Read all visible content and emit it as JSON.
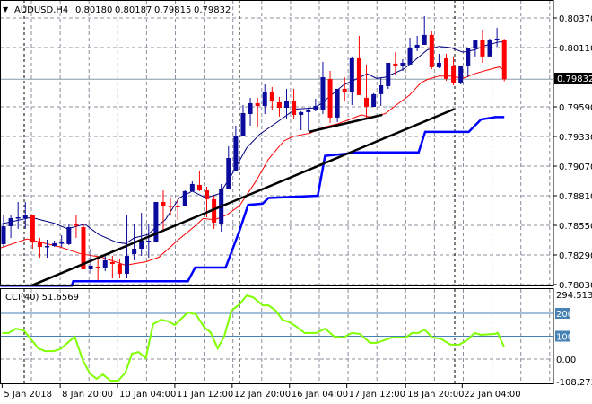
{
  "header": {
    "arrow": "▼",
    "symbol": "AUDUSD,H4",
    "open": "0.80180",
    "high": "0.80187",
    "low": "0.79815",
    "close": "0.79832"
  },
  "colors": {
    "bull": "#0a0a9c",
    "bear": "#ff0000",
    "ma_fast": "#000080",
    "ma_slow": "#ff0000",
    "stop_line": "#0000ff",
    "trendline": "#000000",
    "cci": "#7fff00",
    "level": "#4682b4",
    "grid": "#8c8c9c"
  },
  "chart_data": [
    {
      "type": "candlestick",
      "title": "AUDUSD,H4",
      "ylim": [
        0.7803,
        0.8037
      ],
      "y_ticks": [
        "0.80370",
        "0.80110",
        "0.79590",
        "0.79330",
        "0.79070",
        "0.78810",
        "0.78550",
        "0.78290",
        "0.78030"
      ],
      "current_price_label": "0.79832",
      "x_tick_labels": [
        "5 Jan 2018",
        "8 Jan 20:00",
        "10 Jan 04:00",
        "11 Jan 12:00",
        "12 Jan 20:00",
        "16 Jan 04:00",
        "17 Jan 12:00",
        "18 Jan 20:00",
        "22 Jan 04:00"
      ],
      "x_tick_bar_index": [
        -0.2,
        7.8,
        15.7,
        23.6,
        31.5,
        39.4,
        47.3,
        55.4,
        63.2
      ],
      "grid": true,
      "candles_ohlc": [
        [
          0.78385,
          0.78637,
          0.78361,
          0.78542
        ],
        [
          0.78542,
          0.78637,
          0.7844,
          0.78613
        ],
        [
          0.78613,
          0.78755,
          0.78519,
          0.78621
        ],
        [
          0.78613,
          0.78755,
          0.78519,
          0.78637
        ],
        [
          0.78637,
          0.78637,
          0.78345,
          0.784
        ],
        [
          0.784,
          0.7844,
          0.78266,
          0.78361
        ],
        [
          0.78361,
          0.78424,
          0.78266,
          0.78369
        ],
        [
          0.78369,
          0.78416,
          0.78361,
          0.78393
        ],
        [
          0.78393,
          0.78463,
          0.78361,
          0.784
        ],
        [
          0.78385,
          0.78558,
          0.78377,
          0.78534
        ],
        [
          0.78558,
          0.78637,
          0.7844,
          0.7855
        ],
        [
          0.78534,
          0.78558,
          0.78164,
          0.78164
        ],
        [
          0.78164,
          0.78345,
          0.78125,
          0.78196
        ],
        [
          0.78188,
          0.78282,
          0.7807,
          0.7818
        ],
        [
          0.7818,
          0.78282,
          0.78148,
          0.78243
        ],
        [
          0.78227,
          0.78282,
          0.78085,
          0.78211
        ],
        [
          0.78211,
          0.78259,
          0.78085,
          0.78125
        ],
        [
          0.78125,
          0.78637,
          0.78085,
          0.78282
        ],
        [
          0.78298,
          0.78558,
          0.78243,
          0.78345
        ],
        [
          0.78345,
          0.7866,
          0.78282,
          0.78416
        ],
        [
          0.78408,
          0.78558,
          0.78266,
          0.78416
        ],
        [
          0.784,
          0.78755,
          0.784,
          0.78755
        ],
        [
          0.78755,
          0.78857,
          0.78503,
          0.78723
        ],
        [
          0.78723,
          0.78794,
          0.78637,
          0.78716
        ],
        [
          0.78723,
          0.78779,
          0.78597,
          0.78708
        ],
        [
          0.78716,
          0.78857,
          0.78716,
          0.7885
        ],
        [
          0.7885,
          0.78936,
          0.7885,
          0.78913
        ],
        [
          0.78905,
          0.79031,
          0.7885,
          0.78857
        ],
        [
          0.78857,
          0.78889,
          0.78621,
          0.78779
        ],
        [
          0.78779,
          0.7881,
          0.78519,
          0.78574
        ],
        [
          0.78558,
          0.78913,
          0.78495,
          0.78873
        ],
        [
          0.78873,
          0.79244,
          0.78873,
          0.79141
        ],
        [
          0.79031,
          0.79425,
          0.79031,
          0.7933
        ],
        [
          0.7933,
          0.79606,
          0.7933,
          0.79535
        ],
        [
          0.79527,
          0.79669,
          0.79425,
          0.79622
        ],
        [
          0.79622,
          0.79669,
          0.79409,
          0.79598
        ],
        [
          0.79598,
          0.79787,
          0.79527,
          0.79716
        ],
        [
          0.79716,
          0.79764,
          0.79559,
          0.79638
        ],
        [
          0.7963,
          0.79677,
          0.79504,
          0.79582
        ],
        [
          0.79582,
          0.79748,
          0.79488,
          0.79638
        ],
        [
          0.79638,
          0.79748,
          0.79488,
          0.79519
        ],
        [
          0.79519,
          0.79551,
          0.79385,
          0.79543
        ],
        [
          0.79543,
          0.79582,
          0.79378,
          0.79567
        ],
        [
          0.79567,
          0.79661,
          0.79551,
          0.79598
        ],
        [
          0.79567,
          0.79984,
          0.79527,
          0.7985
        ],
        [
          0.79835,
          0.79906,
          0.79448,
          0.79496
        ],
        [
          0.79496,
          0.79748,
          0.79456,
          0.79748
        ],
        [
          0.79748,
          0.7985,
          0.79638,
          0.79716
        ],
        [
          0.79716,
          0.80032,
          0.79606,
          0.80016
        ],
        [
          0.80016,
          0.80213,
          0.79693,
          0.79693
        ],
        [
          0.79669,
          0.79961,
          0.79488,
          0.7959
        ],
        [
          0.7959,
          0.79709,
          0.79606,
          0.79701
        ],
        [
          0.79701,
          0.7985,
          0.79598,
          0.79779
        ],
        [
          0.79772,
          0.79976,
          0.79748,
          0.79976
        ],
        [
          0.79969,
          0.80071,
          0.79866,
          0.79953
        ],
        [
          0.79953,
          0.80008,
          0.79906,
          0.79976
        ],
        [
          0.79961,
          0.80197,
          0.79961,
          0.8011
        ],
        [
          0.8011,
          0.80213,
          0.80079,
          0.80134
        ],
        [
          0.80134,
          0.80386,
          0.80134,
          0.80221
        ],
        [
          0.80221,
          0.80252,
          0.79921,
          0.79937
        ],
        [
          0.79937,
          0.80055,
          0.79929,
          0.79976
        ],
        [
          0.80016,
          0.80055,
          0.79819,
          0.79835
        ],
        [
          0.79953,
          0.80032,
          0.79779,
          0.79803
        ],
        [
          0.79803,
          0.79953,
          0.79787,
          0.79945
        ],
        [
          0.79945,
          0.8011,
          0.7985,
          0.80102
        ],
        [
          0.80102,
          0.80173,
          0.80032,
          0.80173
        ],
        [
          0.80173,
          0.80268,
          0.79976,
          0.80032
        ],
        [
          0.80032,
          0.80189,
          0.8004,
          0.80173
        ],
        [
          0.80173,
          0.80284,
          0.80118,
          0.80189
        ],
        [
          0.8018,
          0.80187,
          0.79815,
          0.79832
        ]
      ],
      "ma_fast": [
        [
          -0.5,
          0.7856
        ],
        [
          3.8,
          0.7862
        ],
        [
          6.9,
          0.7857
        ],
        [
          8.8,
          0.7852
        ],
        [
          11.2,
          0.7856
        ],
        [
          13.1,
          0.7847
        ],
        [
          15.6,
          0.784
        ],
        [
          16.8,
          0.7839
        ],
        [
          18.0,
          0.7844
        ],
        [
          19.9,
          0.7847
        ],
        [
          21.1,
          0.7854
        ],
        [
          22.3,
          0.786
        ],
        [
          24.2,
          0.7879
        ],
        [
          26.0,
          0.7885
        ],
        [
          27.9,
          0.7879
        ],
        [
          29.8,
          0.7883
        ],
        [
          31.4,
          0.7899
        ],
        [
          33.5,
          0.7923
        ],
        [
          35.3,
          0.7935
        ],
        [
          37.8,
          0.7946
        ],
        [
          40.2,
          0.7957
        ],
        [
          42.7,
          0.7958
        ],
        [
          43.6,
          0.7961
        ],
        [
          46.8,
          0.7978
        ],
        [
          48.5,
          0.7983
        ],
        [
          50.1,
          0.7988
        ],
        [
          51.4,
          0.7984
        ],
        [
          52.6,
          0.7985
        ],
        [
          55.1,
          0.7992
        ],
        [
          56.7,
          0.8
        ],
        [
          58.4,
          0.8009
        ],
        [
          60.0,
          0.8012
        ],
        [
          61.6,
          0.8011
        ],
        [
          63.3,
          0.8007
        ],
        [
          64.9,
          0.8009
        ],
        [
          66.5,
          0.8013
        ],
        [
          68.3,
          0.8016
        ],
        [
          69.0,
          0.8016
        ]
      ],
      "ma_slow": [
        [
          -0.5,
          0.7835
        ],
        [
          3.2,
          0.7843
        ],
        [
          7.8,
          0.7836
        ],
        [
          10.6,
          0.783
        ],
        [
          13.5,
          0.7827
        ],
        [
          16.8,
          0.782
        ],
        [
          19.6,
          0.7823
        ],
        [
          21.4,
          0.7827
        ],
        [
          24.2,
          0.7843
        ],
        [
          26.3,
          0.7854
        ],
        [
          27.5,
          0.7861
        ],
        [
          29.1,
          0.786
        ],
        [
          30.7,
          0.7864
        ],
        [
          32.5,
          0.7872
        ],
        [
          34.9,
          0.7895
        ],
        [
          36.5,
          0.7913
        ],
        [
          38.6,
          0.7929
        ],
        [
          39.9,
          0.7933
        ],
        [
          42.3,
          0.7936
        ],
        [
          44.0,
          0.7941
        ],
        [
          46.0,
          0.7944
        ],
        [
          47.7,
          0.7948
        ],
        [
          49.3,
          0.7952
        ],
        [
          50.5,
          0.795
        ],
        [
          52.6,
          0.7953
        ],
        [
          54.2,
          0.7961
        ],
        [
          55.9,
          0.7969
        ],
        [
          57.5,
          0.798
        ],
        [
          58.4,
          0.7983
        ],
        [
          60.0,
          0.7986
        ],
        [
          61.6,
          0.7986
        ],
        [
          63.3,
          0.7984
        ],
        [
          64.9,
          0.7988
        ],
        [
          66.5,
          0.7991
        ],
        [
          68.3,
          0.7994
        ],
        [
          69.0,
          0.7991
        ]
      ],
      "stop_line": [
        [
          -0.5,
          0.7802
        ],
        [
          9.4,
          0.7802
        ],
        [
          9.6,
          0.7806
        ],
        [
          25.4,
          0.7806
        ],
        [
          26.4,
          0.7818
        ],
        [
          30.6,
          0.7818
        ],
        [
          32.5,
          0.785
        ],
        [
          33.7,
          0.7873
        ],
        [
          35.7,
          0.7874
        ],
        [
          36.5,
          0.7879
        ],
        [
          43.3,
          0.7881
        ],
        [
          44.3,
          0.7916
        ],
        [
          48.9,
          0.7919
        ],
        [
          57.2,
          0.7919
        ],
        [
          58.1,
          0.7937
        ],
        [
          64.1,
          0.7937
        ],
        [
          65.8,
          0.7948
        ],
        [
          67.8,
          0.795
        ],
        [
          69.0,
          0.795
        ]
      ],
      "trendlines": [
        [
          [
            3.8,
            0.7802
          ],
          [
            62.1,
            0.7957
          ]
        ],
        [
          [
            42.1,
            0.7937
          ],
          [
            52.2,
            0.7952
          ]
        ]
      ]
    },
    {
      "type": "line",
      "title": "CCI(40) 51.6569",
      "ylim": [
        -108.2739,
        294.513
      ],
      "y_ticks": [
        "294.513",
        "200",
        "100",
        "0.00",
        "-108.2739"
      ],
      "levels": [
        200,
        100,
        0,
        -100
      ],
      "points": [
        [
          -0.2,
          114
        ],
        [
          0.7,
          114
        ],
        [
          1.7,
          133
        ],
        [
          2.8,
          125
        ],
        [
          3.6,
          94
        ],
        [
          4.8,
          47
        ],
        [
          5.7,
          35
        ],
        [
          6.9,
          35
        ],
        [
          7.8,
          43
        ],
        [
          9.8,
          98
        ],
        [
          10.9,
          -4
        ],
        [
          11.9,
          -63
        ],
        [
          12.8,
          -86
        ],
        [
          13.7,
          -67
        ],
        [
          14.7,
          -94
        ],
        [
          15.8,
          -94
        ],
        [
          16.8,
          -59
        ],
        [
          17.7,
          24
        ],
        [
          18.6,
          31
        ],
        [
          19.6,
          4
        ],
        [
          20.6,
          153
        ],
        [
          21.7,
          172
        ],
        [
          22.7,
          165
        ],
        [
          23.6,
          149
        ],
        [
          25.4,
          204
        ],
        [
          26.5,
          196
        ],
        [
          27.7,
          137
        ],
        [
          28.5,
          118
        ],
        [
          29.5,
          47
        ],
        [
          30.4,
          98
        ],
        [
          31.4,
          212
        ],
        [
          32.5,
          239
        ],
        [
          33.5,
          278
        ],
        [
          34.4,
          270
        ],
        [
          35.7,
          235
        ],
        [
          36.5,
          235
        ],
        [
          37.5,
          212
        ],
        [
          38.4,
          172
        ],
        [
          39.4,
          161
        ],
        [
          40.2,
          145
        ],
        [
          41.5,
          114
        ],
        [
          43.1,
          114
        ],
        [
          44.3,
          133
        ],
        [
          45.6,
          98
        ],
        [
          46.8,
          94
        ],
        [
          48.0,
          114
        ],
        [
          49.1,
          110
        ],
        [
          50.5,
          71
        ],
        [
          51.4,
          71
        ],
        [
          53.5,
          94
        ],
        [
          55.4,
          94
        ],
        [
          56.3,
          114
        ],
        [
          57.2,
          114
        ],
        [
          58.0,
          129
        ],
        [
          59.1,
          94
        ],
        [
          60.2,
          90
        ],
        [
          61.6,
          63
        ],
        [
          62.8,
          63
        ],
        [
          64.0,
          86
        ],
        [
          64.9,
          114
        ],
        [
          65.8,
          106
        ],
        [
          67.7,
          110
        ],
        [
          68.1,
          114
        ],
        [
          69.0,
          51.66
        ]
      ]
    }
  ]
}
